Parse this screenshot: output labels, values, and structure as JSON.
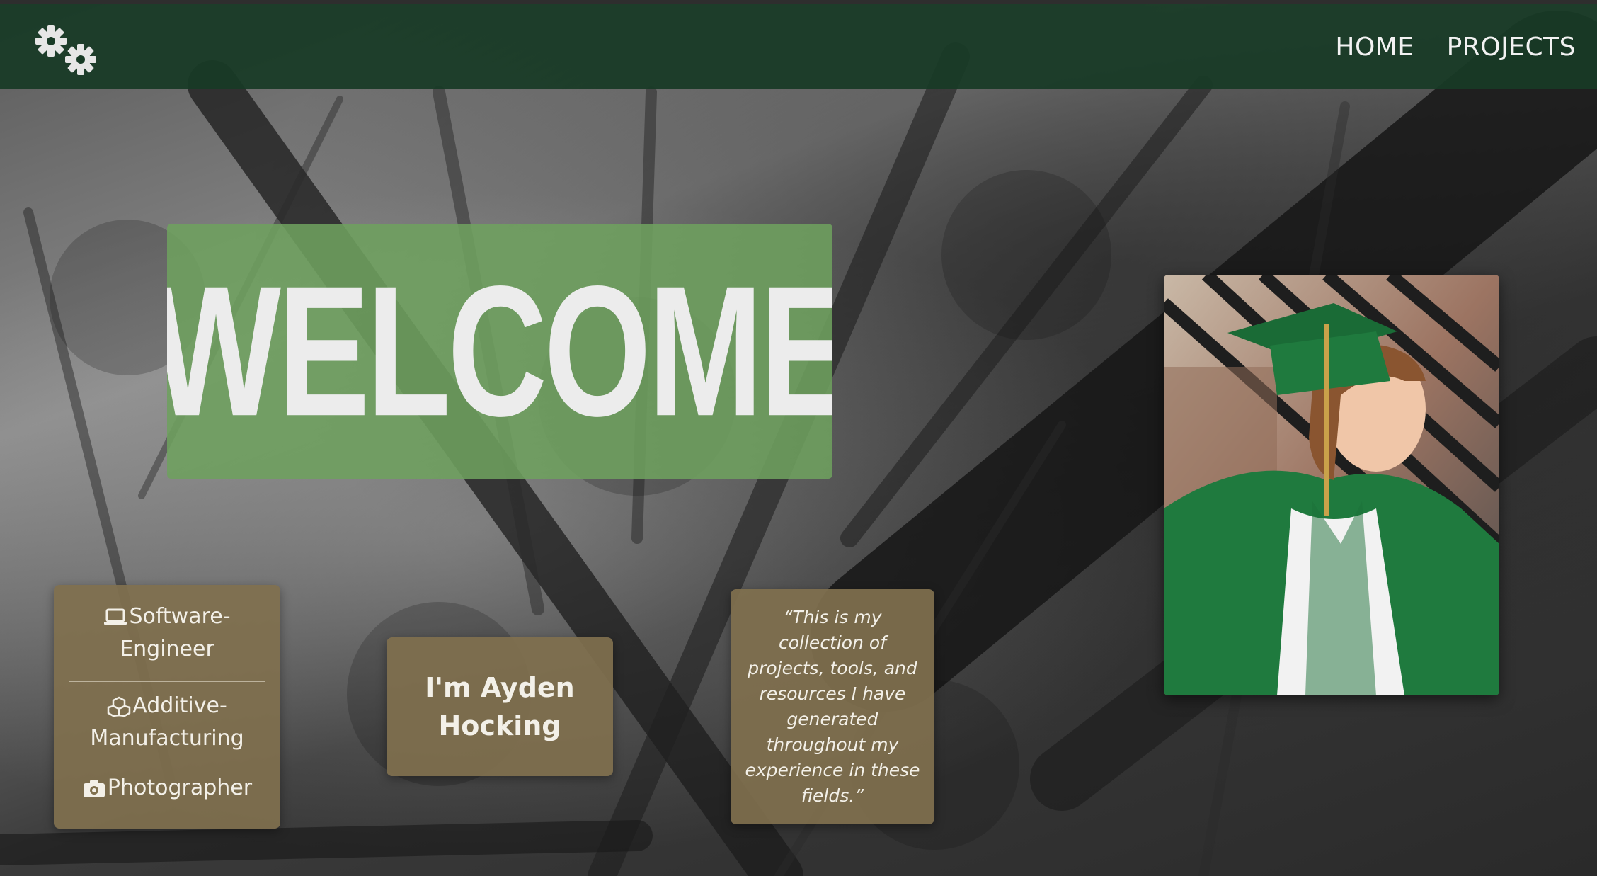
{
  "nav": {
    "logo_icon": "gears-icon",
    "links": [
      {
        "label": "HOME"
      },
      {
        "label": "PROJECTS"
      }
    ]
  },
  "hero": {
    "title": "WELCOME"
  },
  "roles": [
    {
      "icon": "laptop-icon",
      "label": "Software-Engineer"
    },
    {
      "icon": "cubes-icon",
      "label": "Additive-Manufacturing"
    },
    {
      "icon": "camera-icon",
      "label": "Photographer"
    }
  ],
  "intro": {
    "name": "I'm Ayden Hocking"
  },
  "quote": {
    "text": "“This is my collection of projects, tools, and resources I have generated throughout my experience in these fields.”"
  },
  "colors": {
    "navbar": "#183a26",
    "welcome_box": "#6ea05f",
    "card": "#80704e",
    "text_light": "#f3f0e8"
  }
}
